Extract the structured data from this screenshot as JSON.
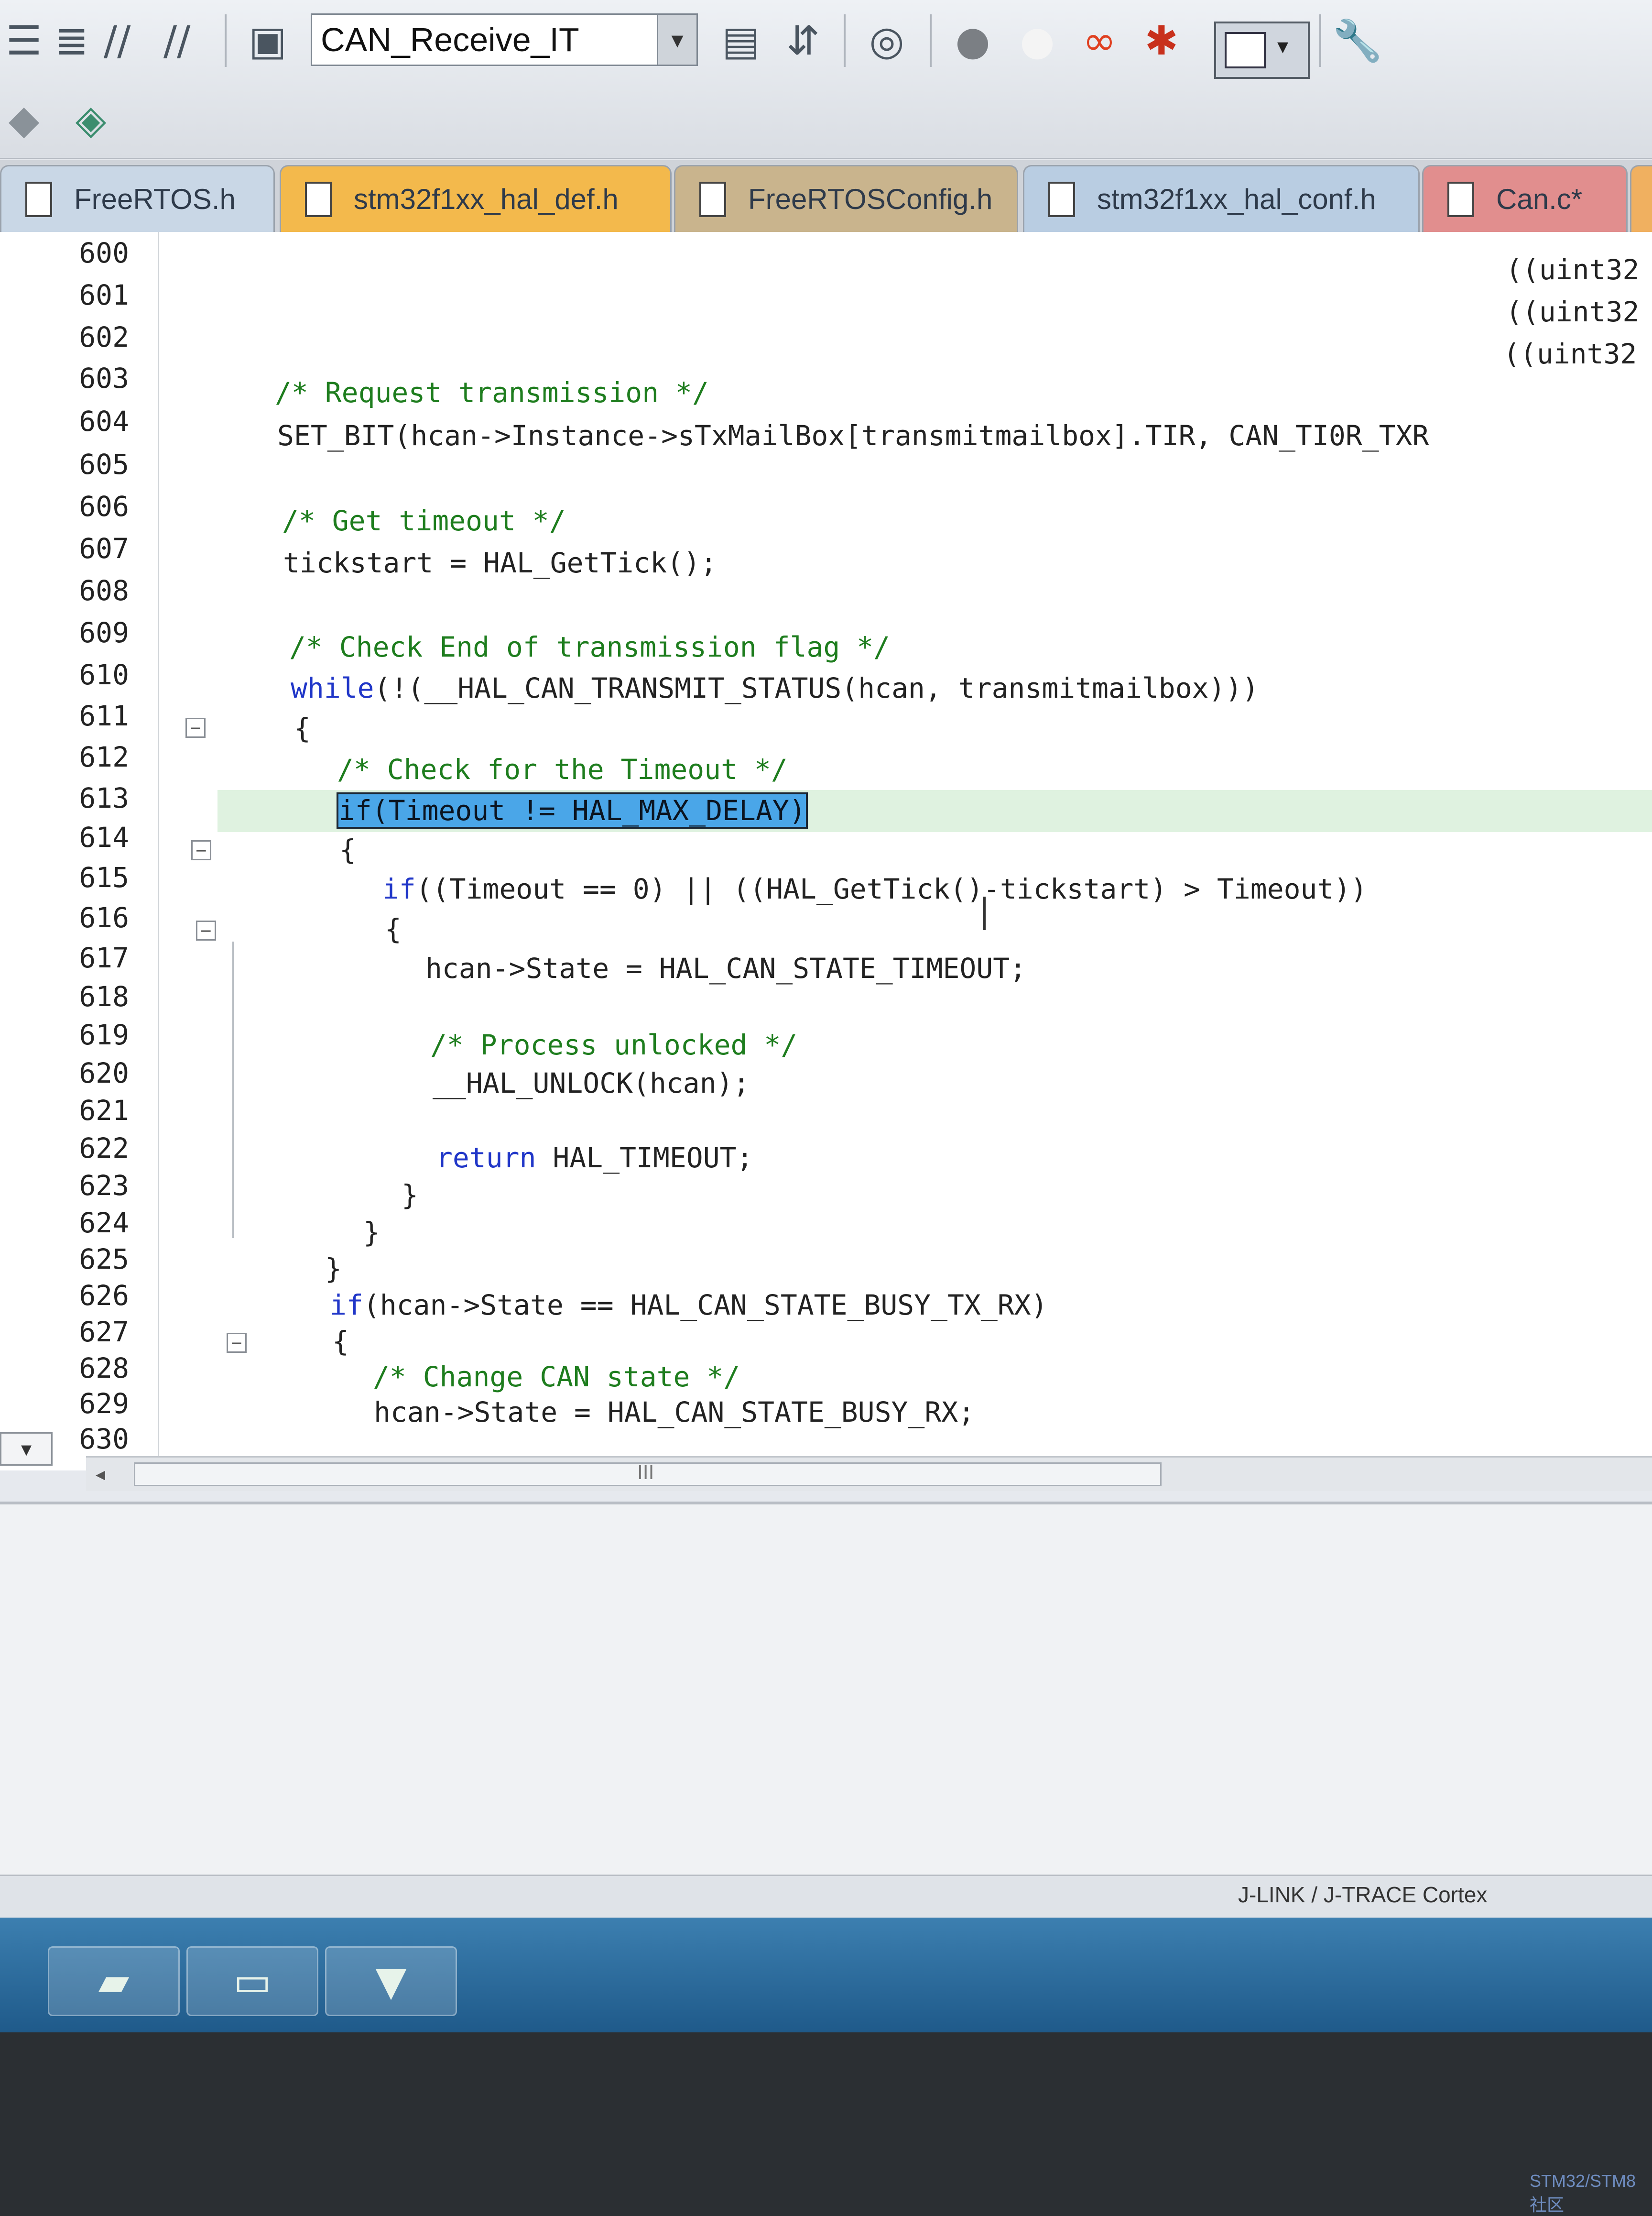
{
  "toolbar": {
    "target_name": "CAN_Receive_IT",
    "icons": [
      "indent-icon",
      "outdent-icon",
      "comment-icon",
      "uncomment-icon",
      "options-icon",
      "manage-icon",
      "load-icon",
      "download-icon",
      "debug-icon",
      "breakpoint-icon",
      "breakpoint-off-icon",
      "kill-breakpoints-icon",
      "disable-breakpoints-icon",
      "window-icon",
      "settings-icon",
      "translate-icon",
      "build-icon"
    ]
  },
  "tabs": [
    {
      "label": "FreeRTOS.h",
      "color": "#c9d7e6"
    },
    {
      "label": "stm32f1xx_hal_def.h",
      "color": "#f3b94c"
    },
    {
      "label": "FreeRTOSConfig.h",
      "color": "#c9b48d"
    },
    {
      "label": "stm32f1xx_hal_conf.h",
      "color": "#b9cde2"
    },
    {
      "label": "Can.c*",
      "color": "#e18e8e"
    }
  ],
  "editor": {
    "line_numbers": [
      "600",
      "601",
      "602",
      "603",
      "604",
      "605",
      "606",
      "607",
      "608",
      "609",
      "610",
      "611",
      "612",
      "613",
      "614",
      "615",
      "616",
      "617",
      "618",
      "619",
      "620",
      "621",
      "622",
      "623",
      "624",
      "625",
      "626",
      "627",
      "628",
      "629",
      "630"
    ],
    "lines": {
      "l600": "((uint32",
      "l601": "((uint32",
      "l602": "((uint32",
      "l603": "/* Request transmission */",
      "l604": "SET_BIT(hcan->Instance->sTxMailBox[transmitmailbox].TIR, CAN_TI0R_TXR",
      "l606": "/* Get timeout */",
      "l607": "tickstart = HAL_GetTick();",
      "l609": "/* Check End of transmission flag */",
      "l610_kw": "while",
      "l610": "(!(__HAL_CAN_TRANSMIT_STATUS(hcan, transmitmailbox)))",
      "l611": "{",
      "l612": "/* Check for the Timeout */",
      "l613": "if(Timeout != HAL_MAX_DELAY)",
      "l614": "{",
      "l615_kw": "if",
      "l615": "((Timeout == 0) || ((HAL_GetTick()-tickstart) > Timeout))",
      "l616": "{",
      "l617": "hcan->State = HAL_CAN_STATE_TIMEOUT;",
      "l619": "/* Process unlocked */",
      "l620": "__HAL_UNLOCK(hcan);",
      "l622_kw": "return",
      "l622": " HAL_TIMEOUT;",
      "l623": "}",
      "l624": "}",
      "l625": "}",
      "l626_kw": "if",
      "l626": "(hcan->State == HAL_CAN_STATE_BUSY_TX_RX)",
      "l627": "{",
      "l628": "/* Change CAN state */",
      "l629": "hcan->State = HAL_CAN_STATE_BUSY_RX;"
    },
    "scroll_thumb_grip": "III"
  },
  "status": {
    "debugger": "J-LINK / J-TRACE Cortex"
  },
  "taskbar": {
    "apps": [
      "chip-app-icon",
      "computer-app-icon",
      "keil-uvision-icon"
    ]
  },
  "bezel": {
    "watermark": "STM32/STM8社区"
  }
}
